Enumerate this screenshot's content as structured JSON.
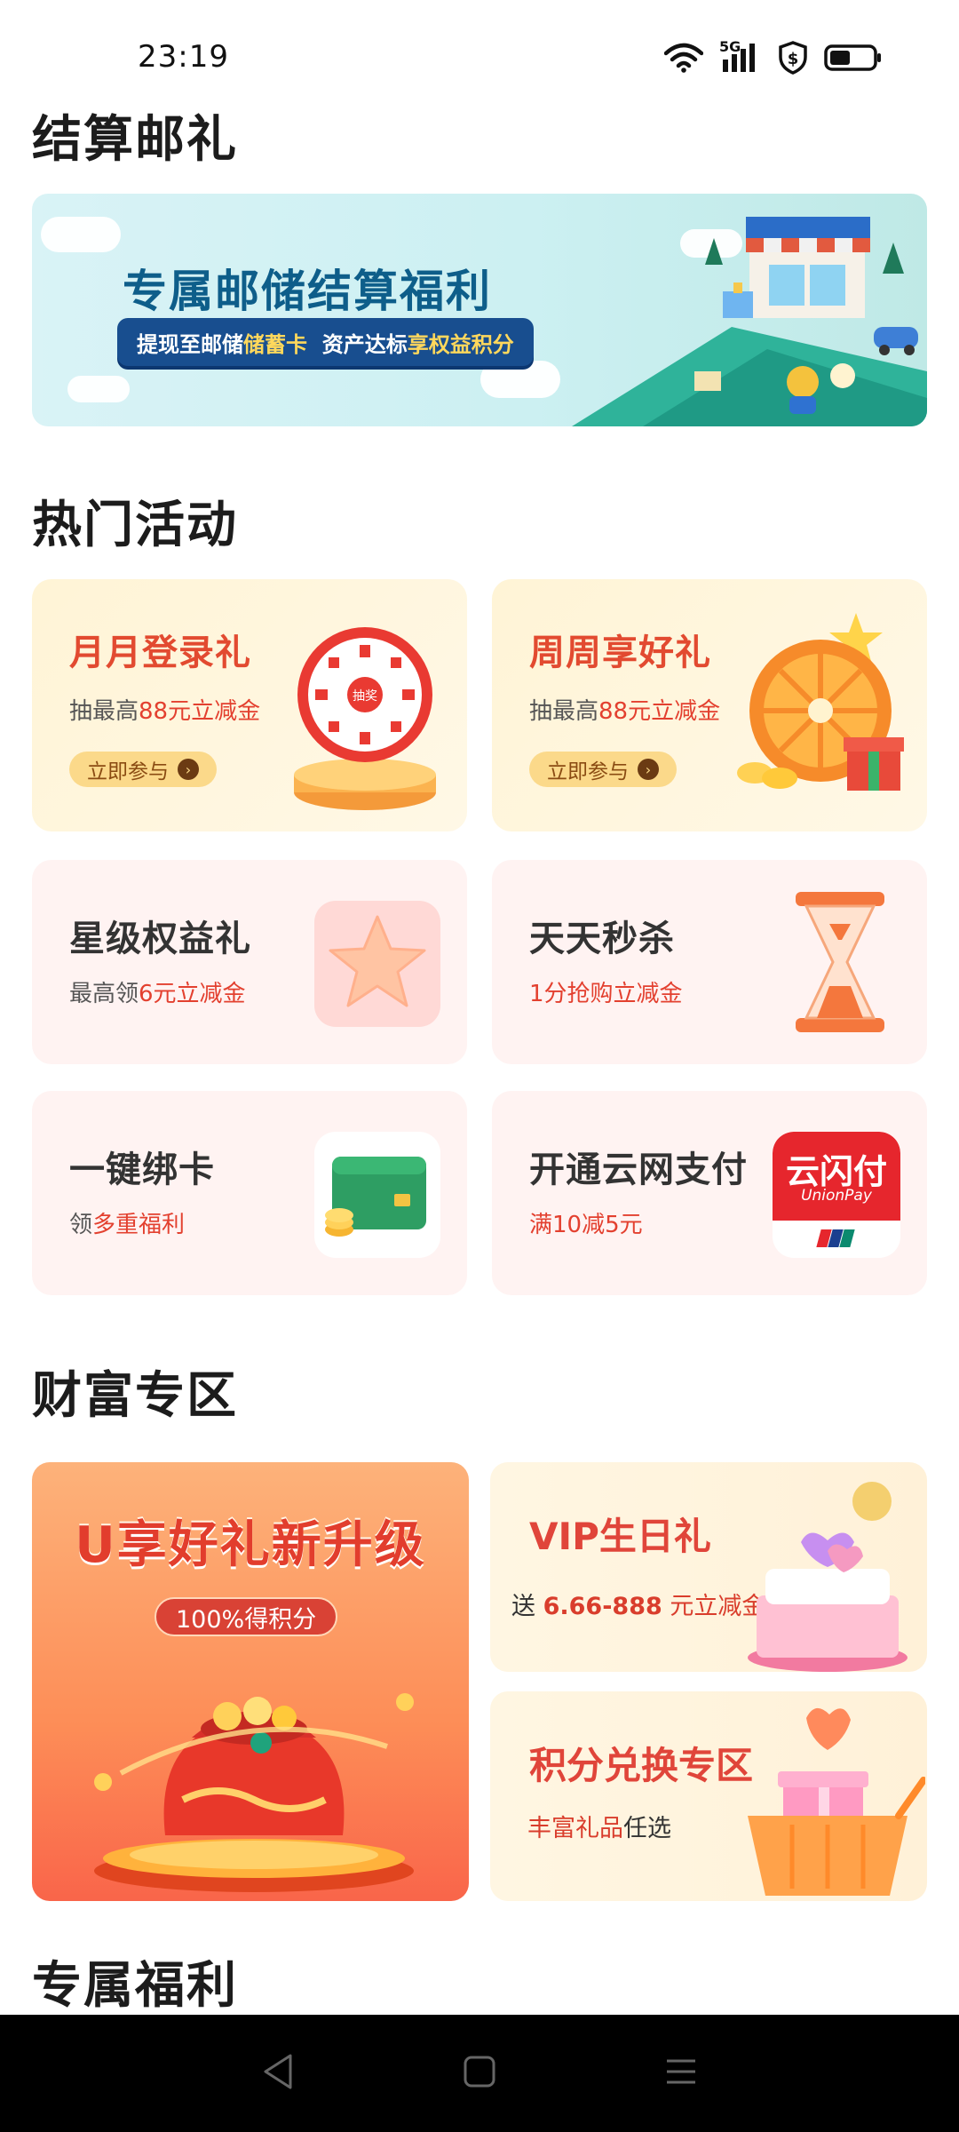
{
  "status_bar": {
    "time": "23:19",
    "icons": [
      "wifi-icon",
      "signal-5g-icon",
      "shield-dollar-icon",
      "battery-icon"
    ],
    "network_label": "5G"
  },
  "sections": {
    "settlement": {
      "title": "结算邮礼"
    },
    "hot": {
      "title": "热门活动"
    },
    "wealth": {
      "title": "财富专区"
    },
    "exclusive": {
      "title": "专属福利"
    }
  },
  "banner": {
    "title": "专属邮储结算福利",
    "pill_part1": "提现至邮储",
    "pill_hl1": "储蓄卡",
    "pill_part2": "  资产达标",
    "pill_hl2": "享权益积分"
  },
  "hot_cards": [
    {
      "title": "月月登录礼",
      "sub_prefix": "抽最高",
      "sub_red": "88元立减金",
      "button": "立即参与",
      "wheel_label": "抽奖"
    },
    {
      "title": "周周享好礼",
      "sub_prefix": "抽最高",
      "sub_red": "88元立减金",
      "button": "立即参与"
    },
    {
      "title": "星级权益礼",
      "sub_prefix": "最高领",
      "sub_red": "6元立减金"
    },
    {
      "title": "天天秒杀",
      "sub_prefix": "",
      "sub_red": "1分抢购立减金"
    },
    {
      "title": "一键绑卡",
      "sub_prefix": "领",
      "sub_red": "多重福利"
    },
    {
      "title": "开通云网支付",
      "sub_prefix": "",
      "sub_red": "满10减5元",
      "logo_text": "云闪付",
      "logo_sub": "UnionPay"
    }
  ],
  "wealth": {
    "big_card": {
      "title": "U享好礼新升级",
      "pill": "100%得积分"
    },
    "vip": {
      "title": "VIP生日礼",
      "sub_prefix": "送 ",
      "sub_red": "6.66-888",
      "sub_suffix": " 元立减金"
    },
    "points": {
      "title": "积分兑换专区",
      "sub_red": "丰富礼品",
      "sub_suffix": "任选"
    }
  },
  "colors": {
    "accent_red": "#e3402f",
    "gold_card_bg": "#fff4d8",
    "pink_card_bg": "#fff3f2",
    "banner_blue": "#184e8f"
  },
  "nav_bar": {
    "icons": [
      "back-icon",
      "home-icon",
      "menu-icon"
    ]
  }
}
